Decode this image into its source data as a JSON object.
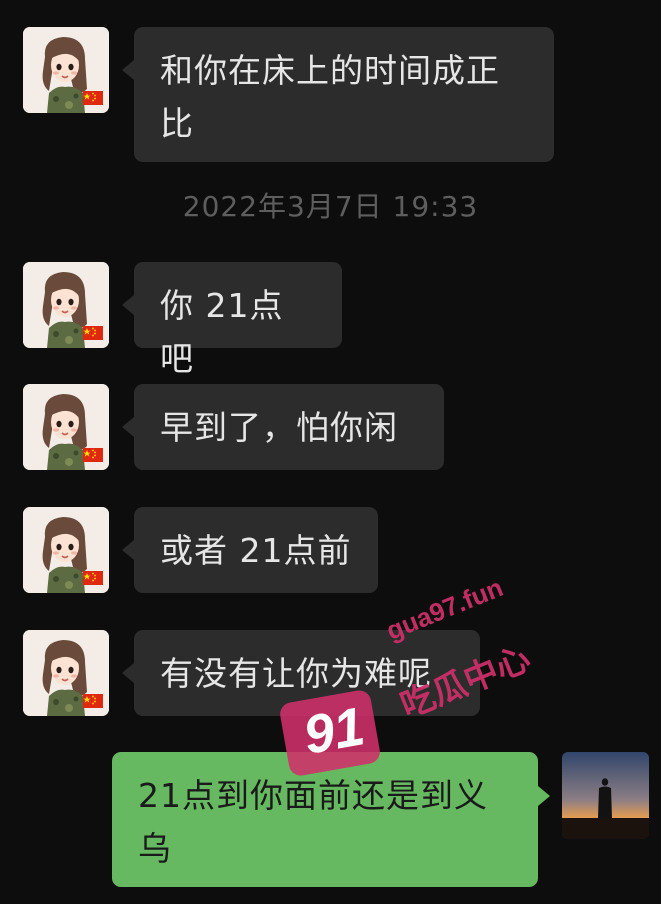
{
  "messages": [
    {
      "sender": "contact",
      "text": "和你在床上的时间成正比"
    },
    {
      "sender": "contact",
      "text": "你 21点吧"
    },
    {
      "sender": "contact",
      "text": "早到了，怕你闲"
    },
    {
      "sender": "contact",
      "text": "或者 21点前"
    },
    {
      "sender": "contact",
      "text": "有没有让你为难呢"
    },
    {
      "sender": "me",
      "text": "21点到你面前还是到义乌"
    }
  ],
  "timestamp": "2022年3月7日 19:33",
  "watermark": {
    "number": "91",
    "site": "gua97.fun",
    "label": "吃瓜中心"
  },
  "colors": {
    "background": "#0d0d0d",
    "incoming_bubble": "#2c2c2c",
    "outgoing_bubble": "#66b960",
    "timestamp_text": "#5e5e5e",
    "watermark": "#d0306a"
  },
  "icons": {
    "contact_avatar": "cartoon-girl-avatar-icon",
    "self_avatar": "sunset-silhouette-avatar-icon",
    "flag": "china-flag-icon"
  }
}
